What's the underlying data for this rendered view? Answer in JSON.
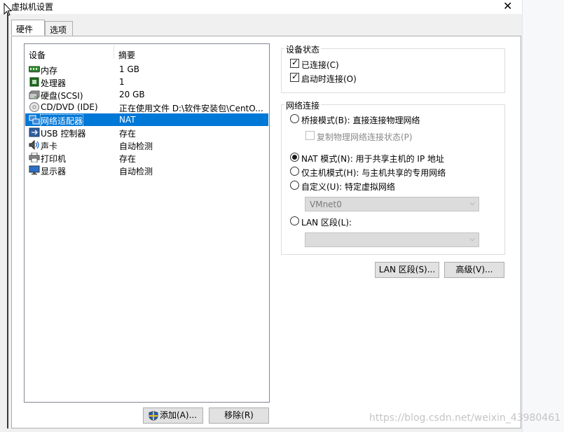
{
  "window": {
    "title": "虚拟机设置",
    "close_glyph": "✕"
  },
  "tabs": [
    {
      "label": "硬件",
      "active": true
    },
    {
      "label": "选项",
      "active": false
    }
  ],
  "device_list": {
    "columns": {
      "device": "设备",
      "summary": "摘要"
    },
    "rows": [
      {
        "icon": "memory-icon",
        "name": "内存",
        "summary": "1 GB",
        "selected": false
      },
      {
        "icon": "processor-icon",
        "name": "处理器",
        "summary": "1",
        "selected": false
      },
      {
        "icon": "harddisk-icon",
        "name": "硬盘(SCSI)",
        "summary": "20 GB",
        "selected": false
      },
      {
        "icon": "cd-dvd-icon",
        "name": "CD/DVD (IDE)",
        "summary": "正在使用文件 D:\\软件安装包\\CentO...",
        "selected": false
      },
      {
        "icon": "network-adapter-icon",
        "name": "网络适配器",
        "summary": "NAT",
        "selected": true
      },
      {
        "icon": "usb-icon",
        "name": "USB 控制器",
        "summary": "存在",
        "selected": false
      },
      {
        "icon": "sound-icon",
        "name": "声卡",
        "summary": "自动检测",
        "selected": false
      },
      {
        "icon": "printer-icon",
        "name": "打印机",
        "summary": "存在",
        "selected": false
      },
      {
        "icon": "display-icon",
        "name": "显示器",
        "summary": "自动检测",
        "selected": false
      }
    ]
  },
  "buttons": {
    "add": "添加(A)...",
    "remove": "移除(R)",
    "lan_segments": "LAN 区段(S)...",
    "advanced": "高级(V)..."
  },
  "device_status": {
    "label": "设备状态",
    "connected": {
      "label": "已连接(C)",
      "checked": true
    },
    "connect_at_power_on": {
      "label": "启动时连接(O)",
      "checked": true
    }
  },
  "network_connection": {
    "label": "网络连接",
    "bridged": {
      "label": "桥接模式(B): 直接连接物理网络",
      "selected": false
    },
    "replicate": {
      "label": "复制物理网络连接状态(P)",
      "checked": false,
      "disabled": true
    },
    "nat": {
      "label": "NAT 模式(N): 用于共享主机的 IP 地址",
      "selected": true
    },
    "host_only": {
      "label": "仅主机模式(H): 与主机共享的专用网络",
      "selected": false
    },
    "custom": {
      "label": "自定义(U): 特定虚拟网络",
      "selected": false
    },
    "custom_network_value": "VMnet0",
    "lan_segment": {
      "label": "LAN 区段(L):",
      "selected": false
    },
    "lan_segment_value": ""
  },
  "watermark": "https://blog.csdn.net/weixin_43980461",
  "colors": {
    "selection": "#0078d7",
    "window_bg": "#f0f0f0"
  }
}
